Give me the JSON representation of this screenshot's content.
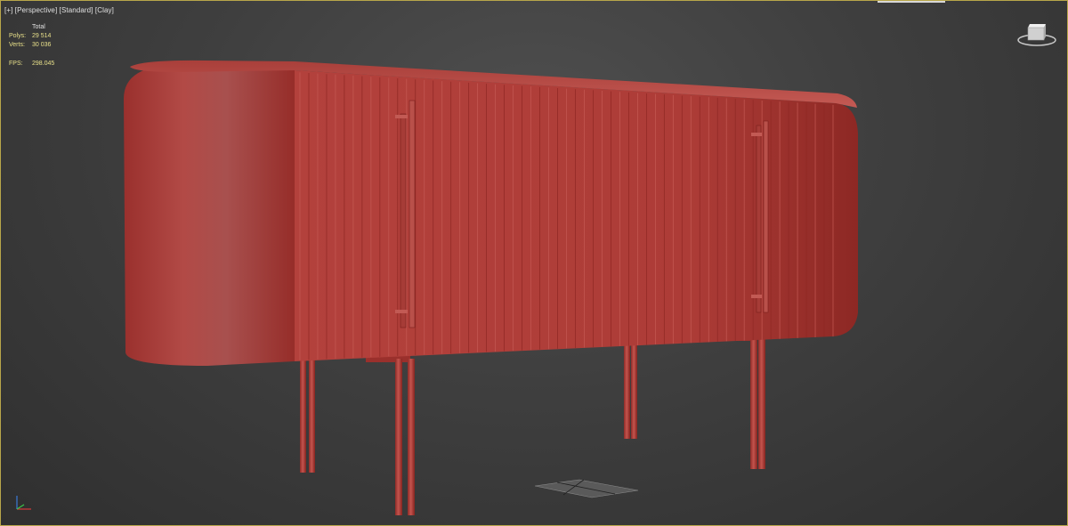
{
  "viewport": {
    "menu_plus": "[+]",
    "view_name": "[Perspective]",
    "shading_mode": "[Standard]",
    "display_style": "[Clay]"
  },
  "statistics": {
    "total_label": "Total",
    "polys_label": "Polys:",
    "polys_value": "29 514",
    "verts_label": "Verts:",
    "verts_value": "30 036",
    "fps_label": "FPS:",
    "fps_value": "298.045"
  },
  "colors": {
    "viewport_border": "#b8a64a",
    "stats_text": "#e8e08a",
    "clay_model": "#b5433f"
  },
  "icons": {
    "viewcube": "viewcube-icon",
    "axis_tripod": "axis-tripod-icon"
  }
}
